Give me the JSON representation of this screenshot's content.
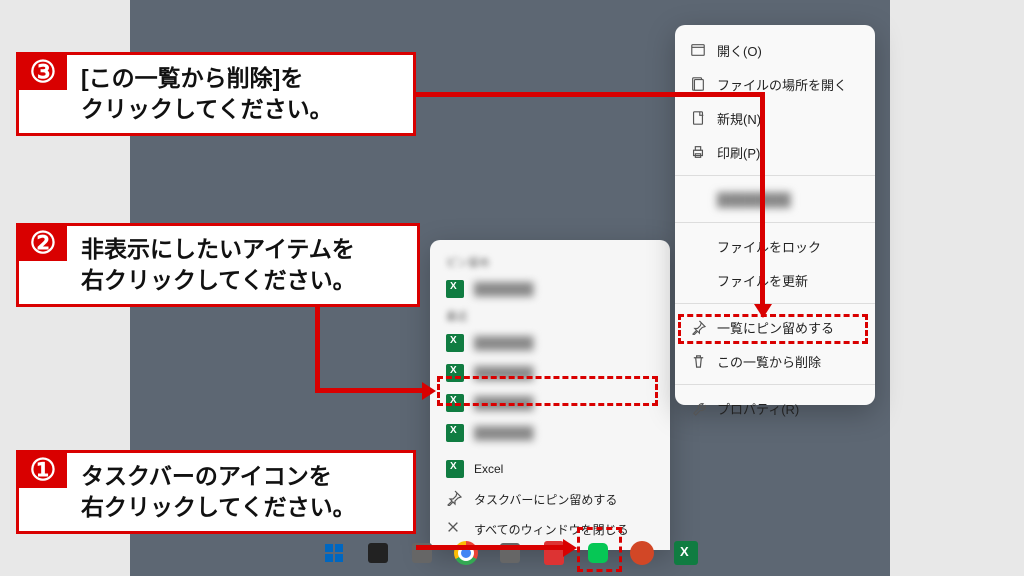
{
  "callouts": {
    "c1": {
      "num": "①",
      "text": "タスクバーのアイコンを\n右クリックしてください。"
    },
    "c2": {
      "num": "②",
      "text": "非表示にしたいアイテムを\n右クリックしてください。"
    },
    "c3": {
      "num": "③",
      "text": "[この一覧から削除]を\nクリックしてください。"
    }
  },
  "jumplist": {
    "app_label": "Excel",
    "pin_label": "タスクバーにピン留めする",
    "close_label": "すべてのウィンドウを閉じる"
  },
  "ctx": {
    "open": "開く(O)",
    "open_location": "ファイルの場所を開く",
    "new": "新規(N)",
    "print": "印刷(P)",
    "lock": "ファイルをロック",
    "refresh": "ファイルを更新",
    "pin": "一覧にピン留めする",
    "remove": "この一覧から削除",
    "properties": "プロパティ(R)"
  }
}
